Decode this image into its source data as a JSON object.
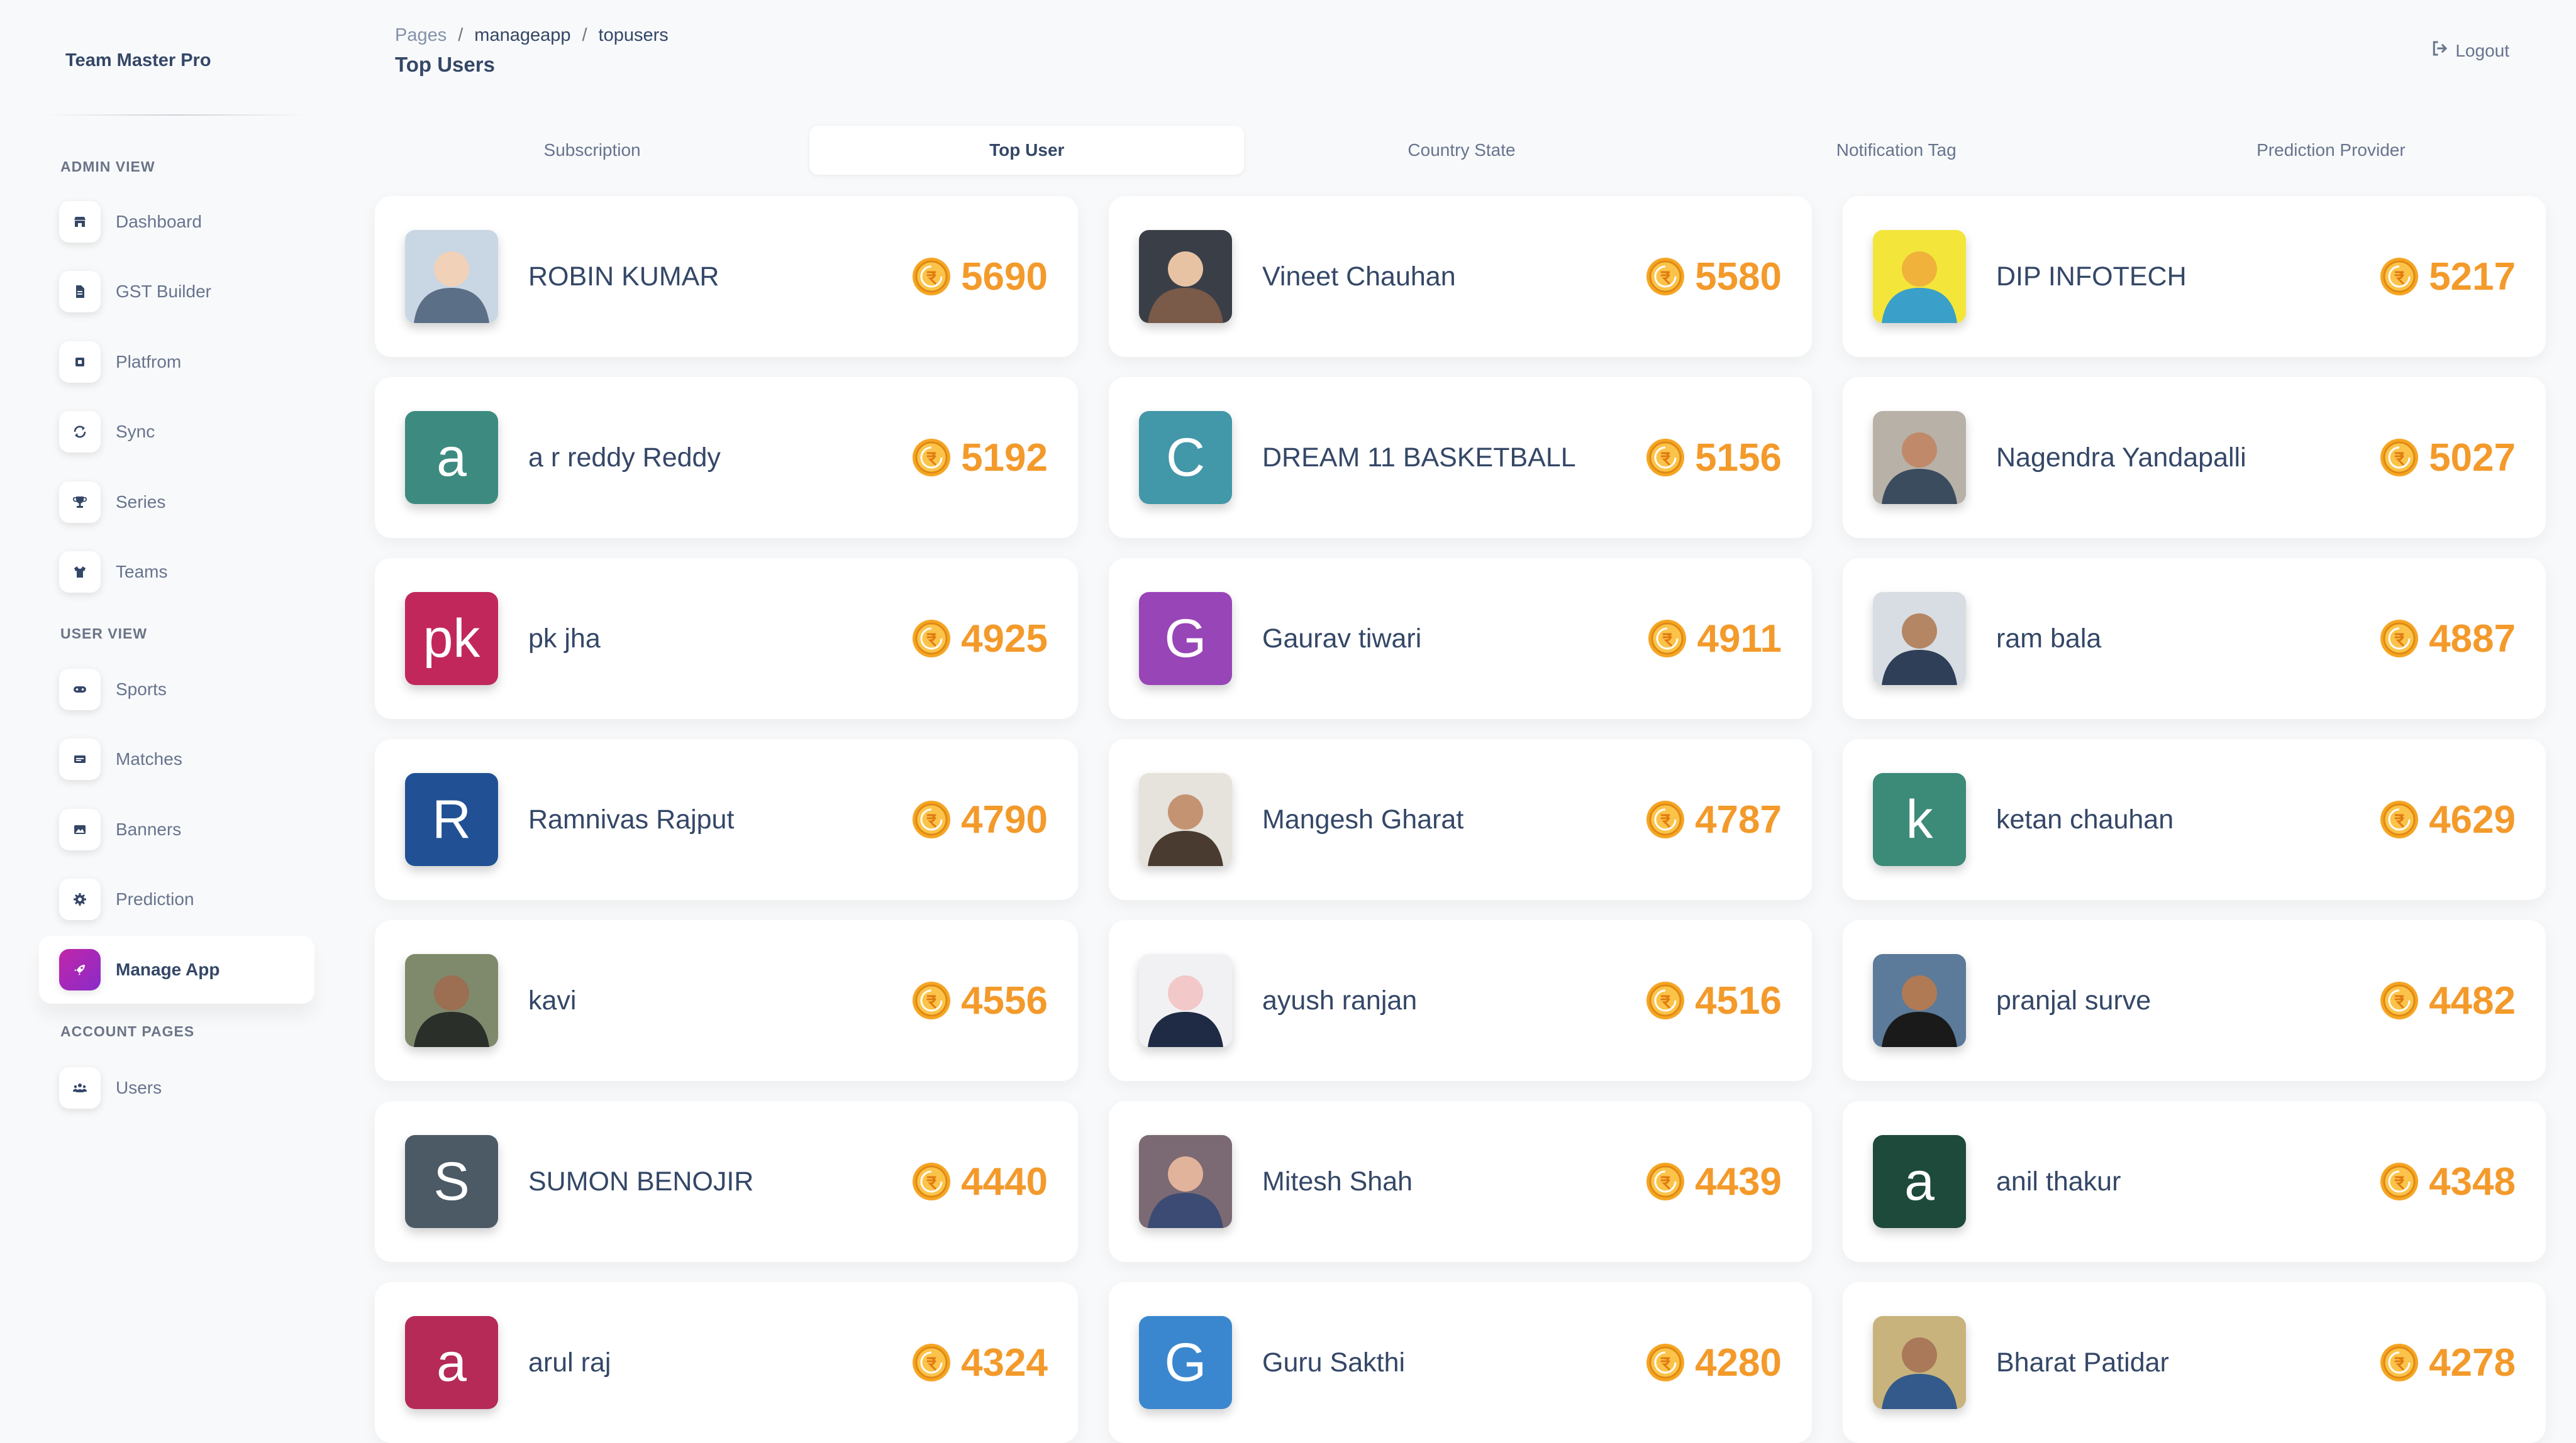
{
  "brand": "Team Master Pro",
  "sidebar": {
    "sections": [
      {
        "title": "ADMIN VIEW"
      },
      {
        "title": "USER VIEW"
      },
      {
        "title": "ACCOUNT PAGES"
      }
    ],
    "items": [
      {
        "label": "Dashboard",
        "icon": "shop-icon"
      },
      {
        "label": "GST Builder",
        "icon": "document-icon"
      },
      {
        "label": "Platfrom",
        "icon": "chip-icon"
      },
      {
        "label": "Sync",
        "icon": "sync-icon"
      },
      {
        "label": "Series",
        "icon": "trophy-icon"
      },
      {
        "label": "Teams",
        "icon": "shirt-icon"
      },
      {
        "label": "Sports",
        "icon": "gamepad-icon"
      },
      {
        "label": "Matches",
        "icon": "ticket-icon"
      },
      {
        "label": "Banners",
        "icon": "image-icon"
      },
      {
        "label": "Prediction",
        "icon": "gear-icon"
      },
      {
        "label": "Manage App",
        "icon": "rocket-icon",
        "active": true
      },
      {
        "label": "Users",
        "icon": "users-icon"
      }
    ]
  },
  "header": {
    "breadcrumb": [
      "Pages",
      "manageapp",
      "topusers"
    ],
    "title": "Top Users",
    "logout_label": "Logout"
  },
  "tabs": [
    {
      "label": "Subscription"
    },
    {
      "label": "Top User",
      "active": true
    },
    {
      "label": "Country State"
    },
    {
      "label": "Notification Tag"
    },
    {
      "label": "Prediction Provider"
    }
  ],
  "colors": {
    "accent": "#f39a2b",
    "active_icon": "#c026a8"
  },
  "users": [
    {
      "name": "ROBIN KUMAR",
      "points": "5690",
      "avatar": {
        "type": "photo"
      }
    },
    {
      "name": "Vineet Chauhan",
      "points": "5580",
      "avatar": {
        "type": "photo"
      }
    },
    {
      "name": "DIP INFOTECH",
      "points": "5217",
      "avatar": {
        "type": "photo"
      }
    },
    {
      "name": "a r reddy Reddy",
      "points": "5192",
      "avatar": {
        "type": "letter",
        "letter": "a",
        "color": "#3d8b80"
      }
    },
    {
      "name": "DREAM 11 BASKETBALL",
      "points": "5156",
      "avatar": {
        "type": "letter",
        "letter": "C",
        "color": "#4297a8"
      }
    },
    {
      "name": "Nagendra Yandapalli",
      "points": "5027",
      "avatar": {
        "type": "photo"
      }
    },
    {
      "name": "pk jha",
      "points": "4925",
      "avatar": {
        "type": "letter",
        "letter": "pk",
        "color": "#c1275a"
      }
    },
    {
      "name": "Gaurav tiwari",
      "points": "4911",
      "avatar": {
        "type": "letter",
        "letter": "G",
        "color": "#9845b8"
      }
    },
    {
      "name": "ram bala",
      "points": "4887",
      "avatar": {
        "type": "photo"
      }
    },
    {
      "name": "Ramnivas Rajput",
      "points": "4790",
      "avatar": {
        "type": "letter",
        "letter": "R",
        "color": "#215194"
      }
    },
    {
      "name": "Mangesh Gharat",
      "points": "4787",
      "avatar": {
        "type": "photo"
      }
    },
    {
      "name": "ketan chauhan",
      "points": "4629",
      "avatar": {
        "type": "letter",
        "letter": "k",
        "color": "#3c8a78"
      }
    },
    {
      "name": "kavi",
      "points": "4556",
      "avatar": {
        "type": "photo"
      }
    },
    {
      "name": "ayush ranjan",
      "points": "4516",
      "avatar": {
        "type": "photo"
      }
    },
    {
      "name": "pranjal surve",
      "points": "4482",
      "avatar": {
        "type": "photo"
      }
    },
    {
      "name": "SUMON BENOJIR",
      "points": "4440",
      "avatar": {
        "type": "letter",
        "letter": "S",
        "color": "#4c5a66"
      }
    },
    {
      "name": "Mitesh Shah",
      "points": "4439",
      "avatar": {
        "type": "photo"
      }
    },
    {
      "name": "anil thakur",
      "points": "4348",
      "avatar": {
        "type": "letter",
        "letter": "a",
        "color": "#1e4a3b"
      }
    },
    {
      "name": "arul raj",
      "points": "4324",
      "avatar": {
        "type": "letter",
        "letter": "a",
        "color": "#b52a57"
      }
    },
    {
      "name": "Guru Sakthi",
      "points": "4280",
      "avatar": {
        "type": "letter",
        "letter": "G",
        "color": "#3b87cf"
      }
    },
    {
      "name": "Bharat Patidar",
      "points": "4278",
      "avatar": {
        "type": "photo"
      }
    }
  ]
}
